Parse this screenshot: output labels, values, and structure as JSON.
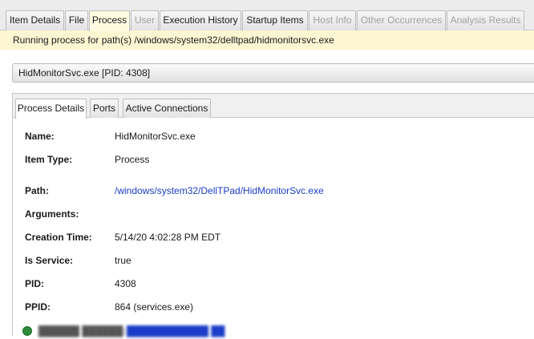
{
  "top_tabs": [
    {
      "label": "Item Details",
      "state": "normal"
    },
    {
      "label": "File",
      "state": "normal"
    },
    {
      "label": "Process",
      "state": "active"
    },
    {
      "label": "User",
      "state": "disabled"
    },
    {
      "label": "Execution History",
      "state": "normal"
    },
    {
      "label": "Startup Items",
      "state": "normal"
    },
    {
      "label": "Host Info",
      "state": "disabled"
    },
    {
      "label": "Other Occurrences",
      "state": "disabled"
    },
    {
      "label": "Analysis Results",
      "state": "disabled"
    }
  ],
  "status_message": "Running process for path(s) /windows/system32/delltpad/hidmonitorsvc.exe",
  "process_header": "HidMonitorSvc.exe  [PID: 4308]",
  "inner_tabs": [
    {
      "label": "Process Details",
      "state": "active"
    },
    {
      "label": "Ports",
      "state": "normal"
    },
    {
      "label": "Active Connections",
      "state": "normal"
    }
  ],
  "details": {
    "name": {
      "label": "Name:",
      "value": "HidMonitorSvc.exe"
    },
    "item_type": {
      "label": "Item Type:",
      "value": "Process"
    },
    "path": {
      "label": "Path:",
      "value": "/windows/system32/DellTPad/HidMonitorSvc.exe"
    },
    "arguments": {
      "label": "Arguments:",
      "value": ""
    },
    "creation_time": {
      "label": "Creation Time:",
      "value": "5/14/20 4:02:28 PM EDT"
    },
    "is_service": {
      "label": "Is Service:",
      "value": "true"
    },
    "pid": {
      "label": "PID:",
      "value": "4308"
    },
    "ppid": {
      "label": "PPID:",
      "value": "864 (services.exe)"
    }
  },
  "colors": {
    "active_tab_bg": "#fffbe0",
    "status_bg": "#fdf6d3",
    "link": "#1a3cc8",
    "status_dot": "#2e8b3a"
  }
}
